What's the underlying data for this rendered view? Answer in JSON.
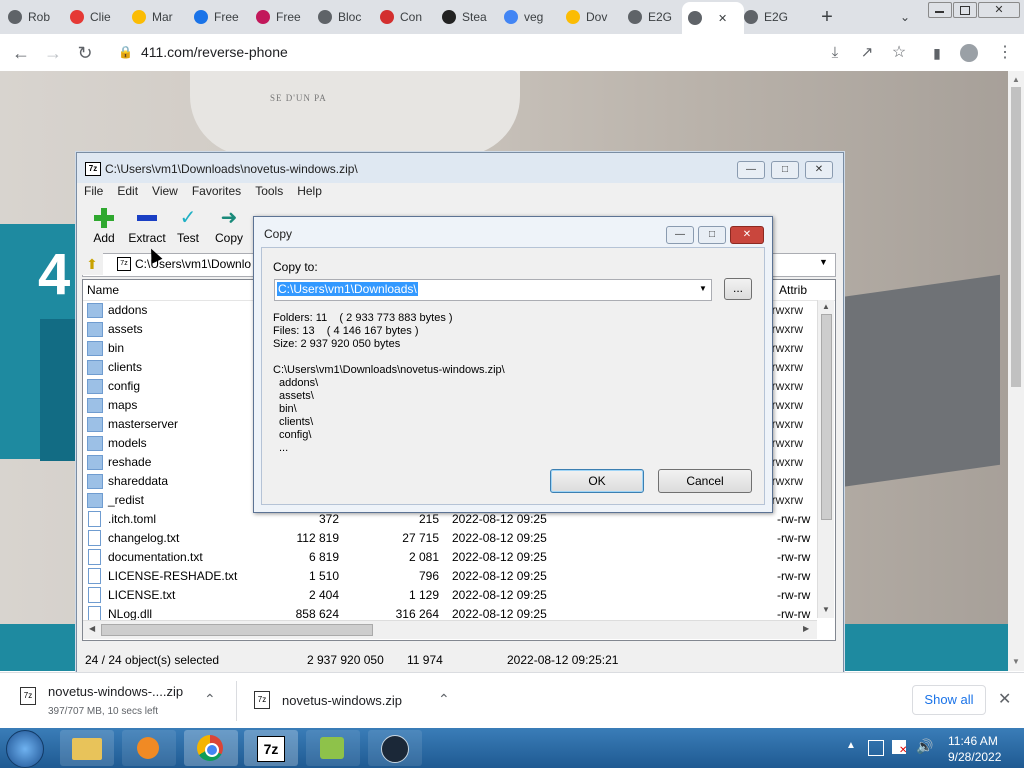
{
  "browser": {
    "tabs": [
      {
        "label": "Rob",
        "icon": "tab-favicon-icon",
        "color": "#5f6368"
      },
      {
        "label": "Clie",
        "icon": "tab-favicon-icon",
        "color": "#e53935"
      },
      {
        "label": "Mar",
        "icon": "google-drive-icon",
        "color": "#fbbc04"
      },
      {
        "label": "Free",
        "icon": "shield-icon",
        "color": "#1a73e8"
      },
      {
        "label": "Free",
        "icon": "tab-favicon-icon",
        "color": "#c2185b"
      },
      {
        "label": "Bloc",
        "icon": "tab-favicon-icon",
        "color": "#5f6368"
      },
      {
        "label": "Con",
        "icon": "tab-favicon-icon",
        "color": "#d32f2f"
      },
      {
        "label": "Stea",
        "icon": "tab-favicon-icon",
        "color": "#222222"
      },
      {
        "label": "veg",
        "icon": "google-icon",
        "color": "#4285f4"
      },
      {
        "label": "Dov",
        "icon": "chrome-icon",
        "color": "#fbbc04"
      },
      {
        "label": "E2G",
        "icon": "tab-favicon-icon",
        "color": "#5f6368"
      },
      {
        "label": "",
        "icon": "tab-favicon-icon",
        "color": "#5f6368"
      },
      {
        "label": "E2G",
        "icon": "tab-favicon-icon",
        "color": "#5f6368"
      }
    ],
    "url": "411.com/reverse-phone"
  },
  "zip": {
    "title": "C:\\Users\\vm1\\Downloads\\novetus-windows.zip\\",
    "menu": [
      "File",
      "Edit",
      "View",
      "Favorites",
      "Tools",
      "Help"
    ],
    "toolbar": [
      "Add",
      "Extract",
      "Test",
      "Copy"
    ],
    "path": "C:\\Users\\vm1\\Downlo",
    "columns": {
      "name": "Name",
      "attrib": "Attrib"
    },
    "folders": [
      "addons",
      "assets",
      "bin",
      "clients",
      "config",
      "maps",
      "masterserver",
      "models",
      "reshade",
      "shareddata",
      "_redist"
    ],
    "folder_attrib": "drwxrw",
    "files": [
      {
        "name": ".itch.toml",
        "size": "372",
        "packed": "215",
        "modified": "2022-08-12 09:25",
        "attrib": "-rw-rw"
      },
      {
        "name": "changelog.txt",
        "size": "112 819",
        "packed": "27 715",
        "modified": "2022-08-12 09:25",
        "attrib": "-rw-rw"
      },
      {
        "name": "documentation.txt",
        "size": "6 819",
        "packed": "2 081",
        "modified": "2022-08-12 09:25",
        "attrib": "-rw-rw"
      },
      {
        "name": "LICENSE-RESHADE.txt",
        "size": "1 510",
        "packed": "796",
        "modified": "2022-08-12 09:25",
        "attrib": "-rw-rw"
      },
      {
        "name": "LICENSE.txt",
        "size": "2 404",
        "packed": "1 129",
        "modified": "2022-08-12 09:25",
        "attrib": "-rw-rw"
      },
      {
        "name": "NLog.dll",
        "size": "858 624",
        "packed": "316 264",
        "modified": "2022-08-12 09:25",
        "attrib": "-rw-rw"
      }
    ],
    "status": {
      "selected": "24 / 24 object(s) selected",
      "size": "2 937 920 050",
      "packed": "11 974",
      "modified": "2022-08-12 09:25:21"
    }
  },
  "copy_dialog": {
    "title": "Copy",
    "copy_to_label": "Copy to:",
    "destination": "C:\\Users\\vm1\\Downloads\\",
    "browse_label": "...",
    "folders_line": "Folders: 11    ( 2 933 773 883 bytes )",
    "files_line": "Files: 13    ( 4 146 167 bytes )",
    "size_line": "Size: 2 937 920 050 bytes",
    "source_path": "C:\\Users\\vm1\\Downloads\\novetus-windows.zip\\",
    "source_items": [
      "addons\\",
      "assets\\",
      "bin\\",
      "clients\\",
      "config\\",
      "..."
    ],
    "ok_label": "OK",
    "cancel_label": "Cancel"
  },
  "downloads": {
    "item1_name": "novetus-windows-....zip",
    "item1_progress": "397/707 MB, 10 secs left",
    "item2_name": "novetus-windows.zip",
    "show_all": "Show all"
  },
  "taskbar": {
    "time": "11:46 AM",
    "date": "9/28/2022"
  },
  "webpage": {
    "big_digit": "4",
    "shirt_text": "SE D'UN PA"
  }
}
